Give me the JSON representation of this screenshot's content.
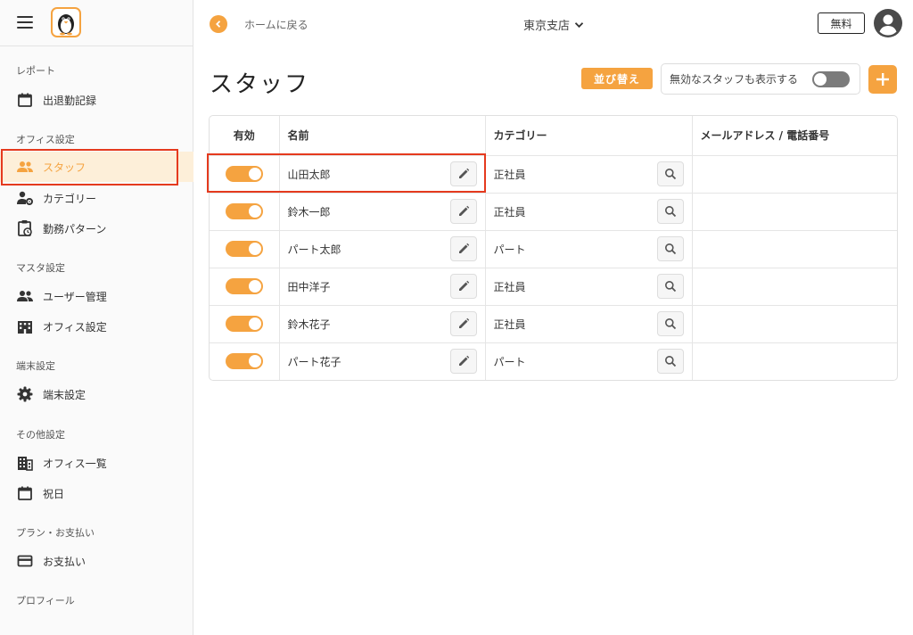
{
  "colors": {
    "accent": "#f5a340",
    "highlight": "#e53a1e",
    "toggle_off": "#7b7b7b"
  },
  "topbar": {
    "back_label": "ホームに戻る",
    "branch": "東京支店",
    "plan_badge": "無料"
  },
  "sidebar": {
    "sections": {
      "report": "レポート",
      "office": "オフィス設定",
      "master": "マスタ設定",
      "device": "端末設定",
      "other": "その他設定",
      "plan": "プラン・お支払い",
      "profile": "プロフィール"
    },
    "items": [
      {
        "label": "出退勤記録",
        "icon": "calendar-icon"
      },
      {
        "label": "スタッフ",
        "icon": "people-icon",
        "active": true
      },
      {
        "label": "カテゴリー",
        "icon": "person-gear-icon"
      },
      {
        "label": "勤務パターン",
        "icon": "clipboard-clock-icon"
      },
      {
        "label": "ユーザー管理",
        "icon": "people-icon"
      },
      {
        "label": "オフィス設定",
        "icon": "building-icon"
      },
      {
        "label": "端末設定",
        "icon": "gear-icon"
      },
      {
        "label": "オフィス一覧",
        "icon": "building-icon"
      },
      {
        "label": "祝日",
        "icon": "calendar-icon"
      },
      {
        "label": "お支払い",
        "icon": "credit-card-icon"
      }
    ]
  },
  "page": {
    "title": "スタッフ",
    "sort_label": "並び替え",
    "show_inactive_label": "無効なスタッフも表示する",
    "show_inactive": false
  },
  "table": {
    "headers": {
      "active": "有効",
      "name": "名前",
      "category": "カテゴリー",
      "contact": "メールアドレス / 電話番号"
    },
    "rows": [
      {
        "active": true,
        "name": "山田太郎",
        "category": "正社員",
        "contact": ""
      },
      {
        "active": true,
        "name": "鈴木一郎",
        "category": "正社員",
        "contact": ""
      },
      {
        "active": true,
        "name": "パート太郎",
        "category": "パート",
        "contact": ""
      },
      {
        "active": true,
        "name": "田中洋子",
        "category": "正社員",
        "contact": ""
      },
      {
        "active": true,
        "name": "鈴木花子",
        "category": "正社員",
        "contact": ""
      },
      {
        "active": true,
        "name": "パート花子",
        "category": "パート",
        "contact": ""
      }
    ]
  }
}
